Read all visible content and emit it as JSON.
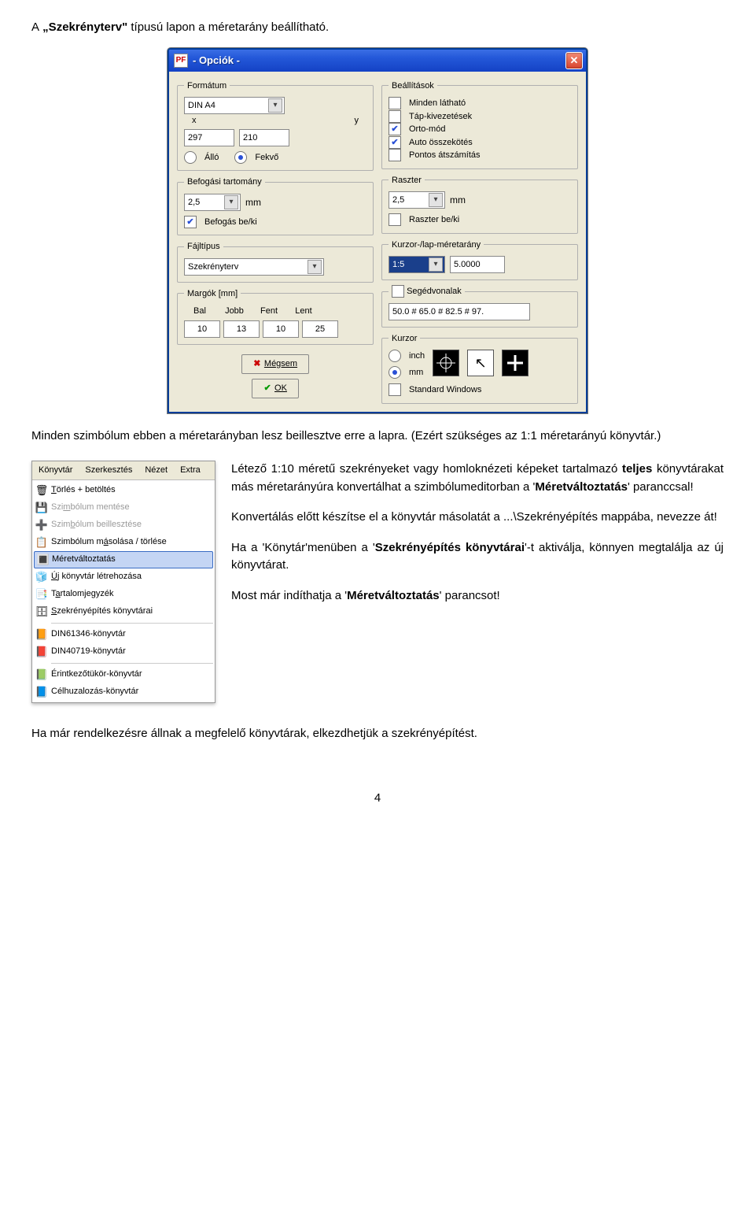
{
  "doc": {
    "intro_1": "A",
    "intro_term_1": " „Szekrényterv\" ",
    "intro_2": "típusú lapon a méretarány beállítható.",
    "after_dialog_1": "Minden szimbólum ebben a méretarányban lesz beillesztve erre a lapra. (Ezért szükséges az 1:1 méretarányú könyvtár.)",
    "p1": "Létező 1:10 méretű szekrényeket vagy homloknézeti képeket tartalmazó ",
    "p1b": "teljes",
    "p1c": " könyvtárakat más méretarányúra konvertálhat a szimbólumeditorban a '",
    "p1d": "Méretváltoztatás",
    "p1e": "' paranccsal!",
    "p2": "Konvertálás előtt készítse el a könyvtár másolatát a ...\\Szekrényépítés mappába, nevezze át!",
    "p3a": "Ha a 'Könytár'menüben a '",
    "p3b": "Szekrényépítés könyvtárai",
    "p3c": "'-t aktiválja, könnyen megtalálja az új könyvtárat.",
    "p4a": "Most már indíthatja a '",
    "p4b": "Méretváltoztatás",
    "p4c": "' parancsot!",
    "final": "Ha már rendelkezésre állnak a megfelelő könyvtárak, elkezdhetjük a szekrényépítést.",
    "page_number": "4"
  },
  "dialog": {
    "title": " - Opciók -",
    "left": {
      "format_legend": "Formátum",
      "format_value": "DIN A4",
      "x_label": "x",
      "y_label": "y",
      "x_value": "297",
      "y_value": "210",
      "orient_portrait": "Álló",
      "orient_landscape": "Fekvő",
      "snap_legend": "Befogási tartomány",
      "snap_value": "2,5",
      "snap_unit": "mm",
      "snap_toggle": "Befogás be/ki",
      "filetype_legend": "Fájltípus",
      "filetype_value": "Szekrényterv",
      "margins_legend": "Margók [mm]",
      "m_left_h": "Bal",
      "m_right_h": "Jobb",
      "m_top_h": "Fent",
      "m_bottom_h": "Lent",
      "m_left": "10",
      "m_right": "13",
      "m_top": "10",
      "m_bottom": "25",
      "btn_cancel": "Mégsem",
      "btn_ok": "OK"
    },
    "right": {
      "settings_legend": "Beállítások",
      "opt1": "Minden látható",
      "opt2": "Táp-kivezetések",
      "opt3": "Orto-mód",
      "opt4": "Auto összekötés",
      "opt5": "Pontos átszámítás",
      "raster_legend": "Raszter",
      "raster_value": "2,5",
      "raster_unit": "mm",
      "raster_toggle": "Raszter be/ki",
      "scale_legend": "Kurzor-/lap-méretarány",
      "scale_sel": "1:5",
      "scale_val": "5.0000",
      "aux_legend": "Segédvonalak",
      "aux_value": "50.0 # 65.0 # 82.5 # 97.",
      "cursor_legend": "Kurzor",
      "cursor_inch": "inch",
      "cursor_mm": "mm",
      "cursor_std": "Standard Windows"
    }
  },
  "menu": {
    "bar": {
      "m1": "Könyvtár",
      "m2": "Szerkesztés",
      "m3": "Nézet",
      "m4": "Extra"
    },
    "items": [
      {
        "label": "Törlés + betöltés",
        "icon": "🗑",
        "u": "T"
      },
      {
        "label": "Szimbólum mentése",
        "icon": "💾",
        "disabled": true,
        "u": "m"
      },
      {
        "label": "Szimbólum beillesztése",
        "icon": "➕",
        "disabled": true,
        "u": "b"
      },
      {
        "label": "Szimbólum másolása / törlése",
        "icon": "📋",
        "u": "á"
      },
      {
        "label": "Méretváltoztatás",
        "icon": "🔳",
        "selected": true
      },
      {
        "label": "Új könyvtár létrehozása",
        "icon": "🧊",
        "u": "Ú"
      },
      {
        "label": "Tartalomjegyzék",
        "icon": "📑",
        "u": "a"
      },
      {
        "label": "Szekrényépítés könyvtárai",
        "icon": "🗄",
        "u": "S"
      },
      {
        "label": "DIN61346-könyvtár",
        "icon": "📙",
        "sep_before": true
      },
      {
        "label": "DIN40719-könyvtár",
        "icon": "📕"
      },
      {
        "label": "Érintkezőtükör-könyvtár",
        "icon": "📗",
        "sep_before": true
      },
      {
        "label": "Célhuzalozás-könyvtár",
        "icon": "📘"
      }
    ]
  }
}
